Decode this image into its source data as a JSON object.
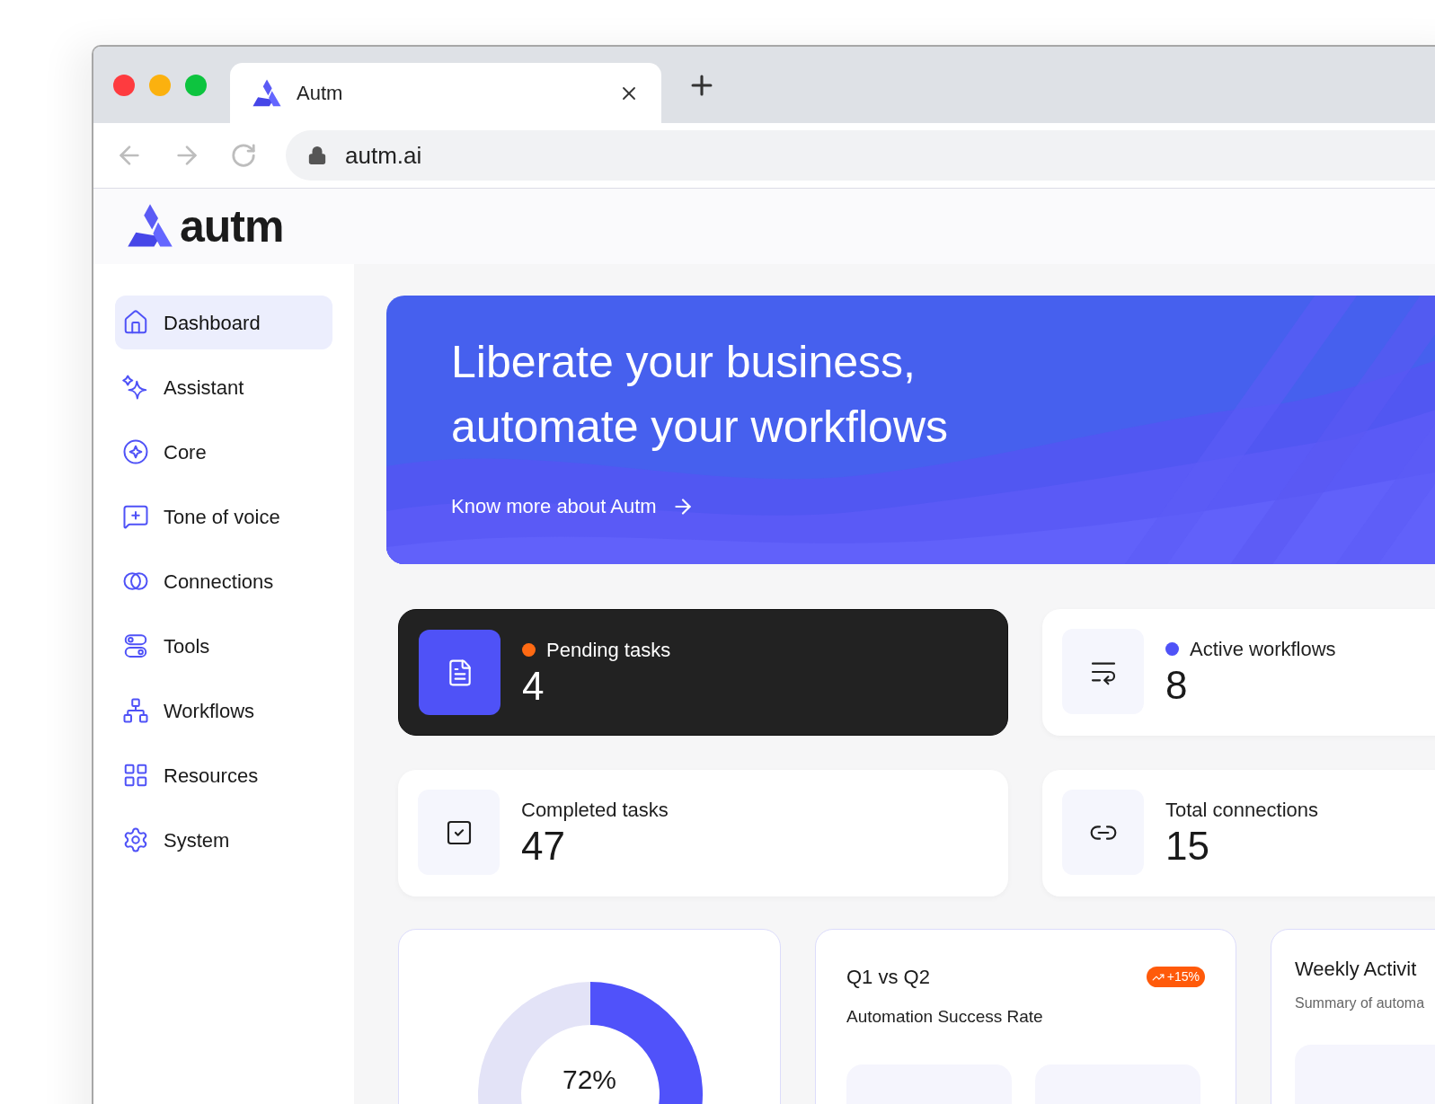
{
  "browser": {
    "tab_title": "Autm",
    "url": "autm.ai"
  },
  "app": {
    "logo_text": "autm"
  },
  "sidebar": {
    "items": [
      {
        "label": "Dashboard",
        "selected": true
      },
      {
        "label": "Assistant",
        "selected": false
      },
      {
        "label": "Core",
        "selected": false
      },
      {
        "label": "Tone of voice",
        "selected": false
      },
      {
        "label": "Connections",
        "selected": false
      },
      {
        "label": "Tools",
        "selected": false
      },
      {
        "label": "Workflows",
        "selected": false
      },
      {
        "label": "Resources",
        "selected": false
      },
      {
        "label": "System",
        "selected": false
      }
    ]
  },
  "banner": {
    "title_lines": [
      "Liberate your business,",
      "automate your workflows"
    ],
    "link": "Know more about Autm"
  },
  "stats": [
    {
      "kind": "highlight",
      "label": "Pending tasks",
      "value": "4",
      "color": "#ff6a13"
    },
    {
      "kind": "plain",
      "label": "Active workflows",
      "value": "8",
      "color": "#4f52f7"
    },
    {
      "kind": "plain",
      "label": "Completed tasks",
      "value": "47"
    },
    {
      "kind": "plain",
      "label": "Total connections",
      "value": "15"
    }
  ],
  "cards": [
    {
      "kind": "gauge",
      "chart_data": {
        "type": "donut",
        "values": [
          72,
          28
        ]
      },
      "reading": "72%"
    },
    {
      "kind": "comparison",
      "title": "Q1 vs Q2",
      "subtitle": "Automation Success Rate",
      "badge": "+15%"
    },
    {
      "kind": "activity",
      "title": "Weekly Activit",
      "subtitle": "Summary of automa"
    }
  ]
}
